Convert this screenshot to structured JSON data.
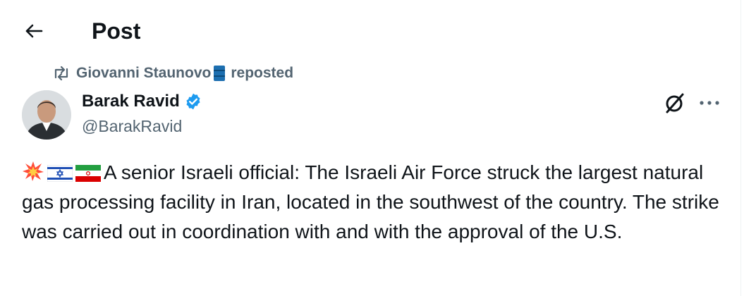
{
  "header": {
    "title": "Post"
  },
  "repost": {
    "user": "Giovanni Staunovo",
    "suffix": "reposted"
  },
  "post": {
    "author_name": "Barak Ravid",
    "author_handle": "@BarakRavid",
    "verified": true,
    "emojis": [
      "collision",
      "israel-flag",
      "iran-flag"
    ],
    "text": "A senior Israeli official: The Israeli Air Force struck the largest natural gas processing facility in Iran, located in the southwest of the country. The strike was carried out in coordination with and with the approval of the U.S."
  },
  "colors": {
    "text": "#0f1419",
    "secondary": "#536471",
    "verified": "#1d9bf0",
    "background": "#ffffff"
  },
  "icons": [
    "back-arrow-icon",
    "repost-icon",
    "oil-barrel-icon",
    "verified-badge-icon",
    "grok-icon",
    "more-icon"
  ]
}
